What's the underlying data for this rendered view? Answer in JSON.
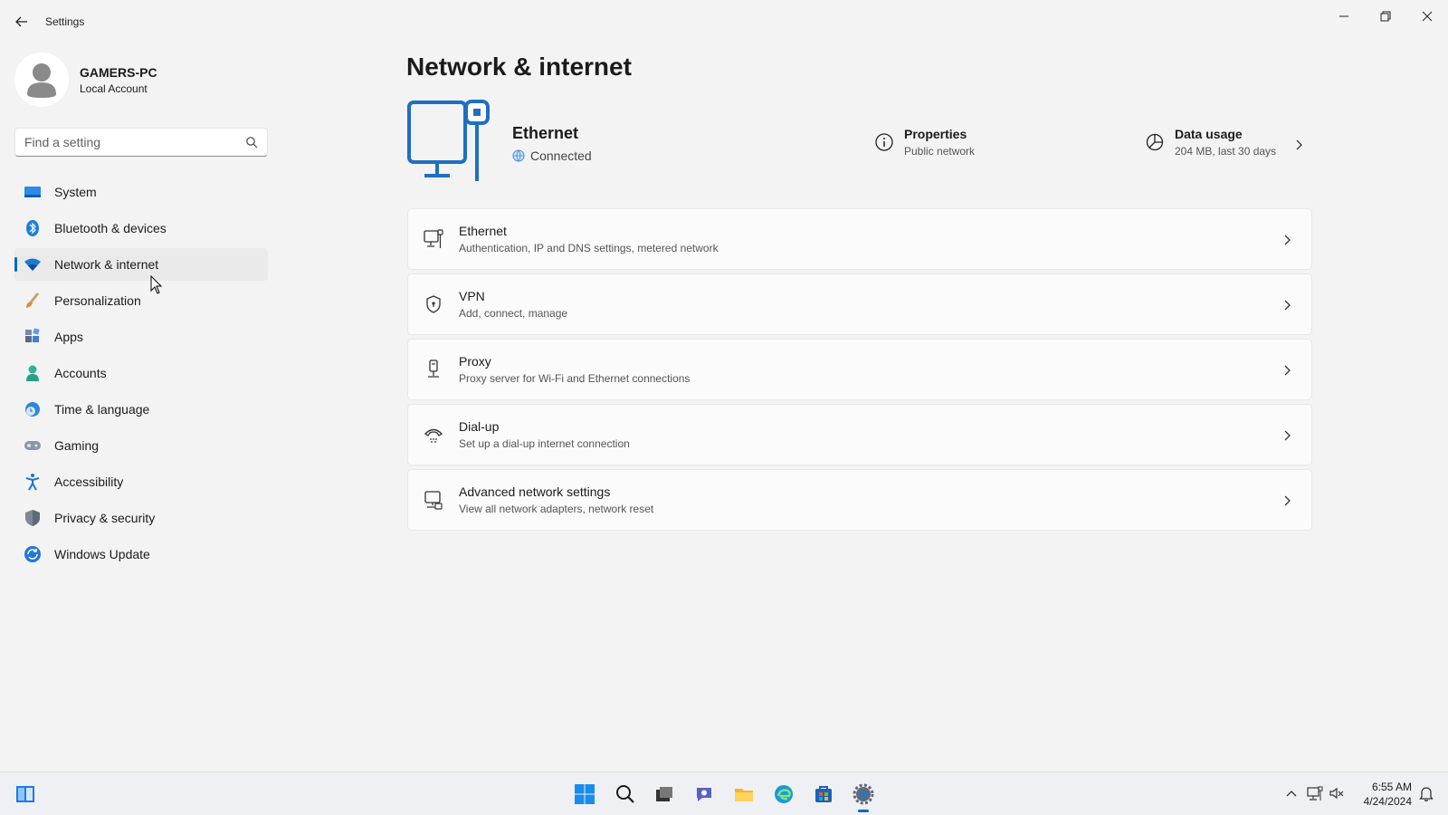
{
  "window": {
    "app_title": "Settings",
    "minimize_label": "Minimize",
    "maximize_label": "Restore",
    "close_label": "Close"
  },
  "user": {
    "name": "GAMERS-PC",
    "account_type": "Local Account"
  },
  "search": {
    "placeholder": "Find a setting",
    "value": ""
  },
  "nav": {
    "active": "Network & internet",
    "items": [
      {
        "label": "System",
        "icon": "monitor-icon"
      },
      {
        "label": "Bluetooth & devices",
        "icon": "bluetooth-icon"
      },
      {
        "label": "Network & internet",
        "icon": "wifi-icon"
      },
      {
        "label": "Personalization",
        "icon": "brush-icon"
      },
      {
        "label": "Apps",
        "icon": "apps-icon"
      },
      {
        "label": "Accounts",
        "icon": "person-icon"
      },
      {
        "label": "Time & language",
        "icon": "clock-globe-icon"
      },
      {
        "label": "Gaming",
        "icon": "gamepad-icon"
      },
      {
        "label": "Accessibility",
        "icon": "accessibility-icon"
      },
      {
        "label": "Privacy & security",
        "icon": "shield-icon"
      },
      {
        "label": "Windows Update",
        "icon": "update-icon"
      }
    ]
  },
  "main": {
    "title": "Network & internet",
    "hero": {
      "name": "Ethernet",
      "status": "Connected",
      "properties_title": "Properties",
      "properties_sub": "Public network",
      "usage_title": "Data usage",
      "usage_sub": "204 MB, last 30 days"
    },
    "cards": [
      {
        "title": "Ethernet",
        "subtitle": "Authentication, IP and DNS settings, metered network",
        "icon": "ethernet-icon"
      },
      {
        "title": "VPN",
        "subtitle": "Add, connect, manage",
        "icon": "vpn-shield-icon"
      },
      {
        "title": "Proxy",
        "subtitle": "Proxy server for Wi-Fi and Ethernet connections",
        "icon": "proxy-icon"
      },
      {
        "title": "Dial-up",
        "subtitle": "Set up a dial-up internet connection",
        "icon": "dialup-icon"
      },
      {
        "title": "Advanced network settings",
        "subtitle": "View all network adapters, network reset",
        "icon": "network-adapter-icon"
      }
    ]
  },
  "taskbar": {
    "time": "6:55 AM",
    "date": "4/24/2024"
  },
  "colors": {
    "accent": "#0067c0",
    "background": "#f3f3f3",
    "card": "#fbfbfb"
  }
}
